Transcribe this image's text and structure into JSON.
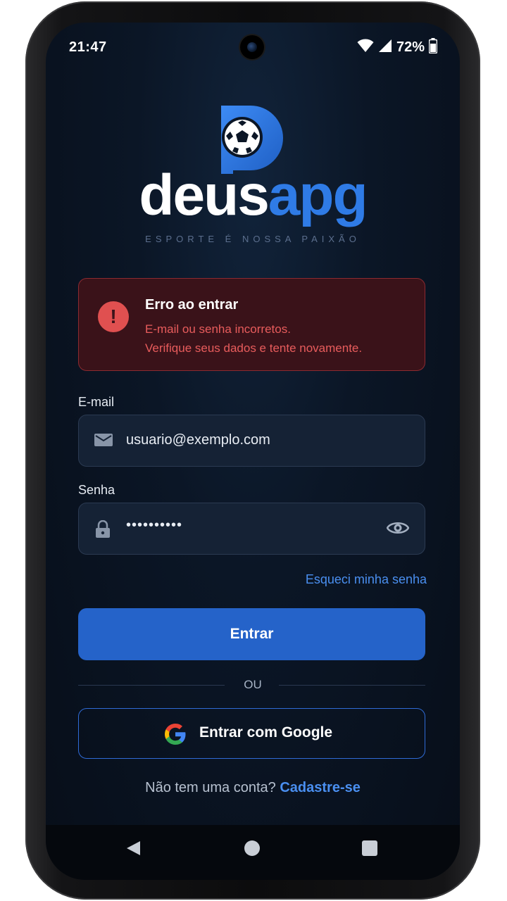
{
  "status_bar": {
    "time": "21:47",
    "battery_percent": "72%"
  },
  "logo": {
    "word_white": "deus",
    "word_blue": "apg",
    "tagline": "ESPORTE É NOSSA PAIXÃO"
  },
  "error": {
    "title": "Erro ao entrar",
    "line1": "E-mail ou senha incorretos.",
    "line2": "Verifique seus dados e tente novamente.",
    "icon_symbol": "!"
  },
  "email": {
    "label": "E-mail",
    "value": "usuario@exemplo.com",
    "icon": "mail-icon"
  },
  "password": {
    "label": "Senha",
    "value": "••••••••••",
    "icon": "lock-icon",
    "toggle_icon": "eye-icon"
  },
  "forgot_password": "Esqueci minha senha",
  "login_button": "Entrar",
  "divider_text": "OU",
  "google_button": "Entrar com Google",
  "signup": {
    "prompt": "Não tem uma conta?",
    "link": "Cadastre-se"
  },
  "colors": {
    "accent": "#2563c9",
    "link": "#4a8ff0",
    "error": "#e05050",
    "background": "#0b1626"
  }
}
